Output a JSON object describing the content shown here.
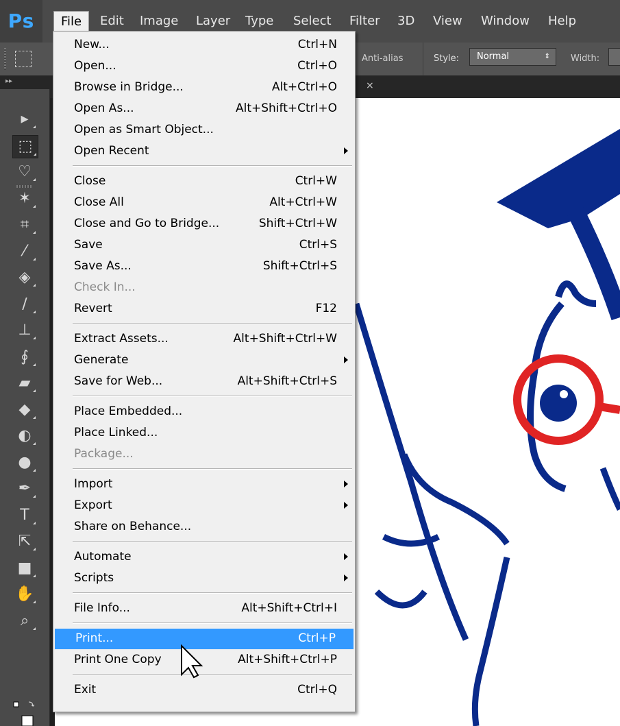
{
  "app": {
    "logo": "Ps"
  },
  "menubar": {
    "items": [
      "File",
      "Edit",
      "Image",
      "Layer",
      "Type",
      "Select",
      "Filter",
      "3D",
      "View",
      "Window",
      "Help"
    ],
    "active": "File"
  },
  "options_bar": {
    "anti_alias": "Anti-alias",
    "style_label": "Style:",
    "style_value": "Normal",
    "width_label": "Width:"
  },
  "tab_bar": {
    "close_glyph": "×"
  },
  "file_menu": {
    "groups": [
      [
        {
          "label": "New...",
          "shortcut": "Ctrl+N"
        },
        {
          "label": "Open...",
          "shortcut": "Ctrl+O"
        },
        {
          "label": "Browse in Bridge...",
          "shortcut": "Alt+Ctrl+O"
        },
        {
          "label": "Open As...",
          "shortcut": "Alt+Shift+Ctrl+O"
        },
        {
          "label": "Open as Smart Object...",
          "shortcut": ""
        },
        {
          "label": "Open Recent",
          "shortcut": "",
          "submenu": true
        }
      ],
      [
        {
          "label": "Close",
          "shortcut": "Ctrl+W"
        },
        {
          "label": "Close All",
          "shortcut": "Alt+Ctrl+W"
        },
        {
          "label": "Close and Go to Bridge...",
          "shortcut": "Shift+Ctrl+W"
        },
        {
          "label": "Save",
          "shortcut": "Ctrl+S"
        },
        {
          "label": "Save As...",
          "shortcut": "Shift+Ctrl+S"
        },
        {
          "label": "Check In...",
          "shortcut": "",
          "disabled": true
        },
        {
          "label": "Revert",
          "shortcut": "F12"
        }
      ],
      [
        {
          "label": "Extract Assets...",
          "shortcut": "Alt+Shift+Ctrl+W"
        },
        {
          "label": "Generate",
          "shortcut": "",
          "submenu": true
        },
        {
          "label": "Save for Web...",
          "shortcut": "Alt+Shift+Ctrl+S"
        }
      ],
      [
        {
          "label": "Place Embedded...",
          "shortcut": ""
        },
        {
          "label": "Place Linked...",
          "shortcut": ""
        },
        {
          "label": "Package...",
          "shortcut": "",
          "disabled": true
        }
      ],
      [
        {
          "label": "Import",
          "shortcut": "",
          "submenu": true
        },
        {
          "label": "Export",
          "shortcut": "",
          "submenu": true
        },
        {
          "label": "Share on Behance...",
          "shortcut": ""
        }
      ],
      [
        {
          "label": "Automate",
          "shortcut": "",
          "submenu": true
        },
        {
          "label": "Scripts",
          "shortcut": "",
          "submenu": true
        }
      ],
      [
        {
          "label": "File Info...",
          "shortcut": "Alt+Shift+Ctrl+I"
        }
      ],
      [
        {
          "label": "Print...",
          "shortcut": "Ctrl+P",
          "highlighted": true
        },
        {
          "label": "Print One Copy",
          "shortcut": "Alt+Shift+Ctrl+P"
        }
      ],
      [
        {
          "label": "Exit",
          "shortcut": "Ctrl+Q"
        }
      ]
    ]
  },
  "toolbar": {
    "tools": [
      {
        "name": "move-tool",
        "glyph": "▸"
      },
      {
        "name": "rectangular-marquee-tool",
        "glyph": "⬚",
        "selected": true
      },
      {
        "name": "lasso-tool",
        "glyph": "♡"
      },
      {
        "name": "magic-wand-tool",
        "glyph": "✶"
      },
      {
        "name": "crop-tool",
        "glyph": "⌗"
      },
      {
        "name": "eyedropper-tool",
        "glyph": "⁄"
      },
      {
        "name": "healing-brush-tool",
        "glyph": "◈"
      },
      {
        "name": "brush-tool",
        "glyph": "∕"
      },
      {
        "name": "clone-stamp-tool",
        "glyph": "⊥"
      },
      {
        "name": "history-brush-tool",
        "glyph": "∮"
      },
      {
        "name": "eraser-tool",
        "glyph": "▰"
      },
      {
        "name": "paint-bucket-tool",
        "glyph": "◆"
      },
      {
        "name": "blur-tool",
        "glyph": "◐"
      },
      {
        "name": "dodge-tool",
        "glyph": "●"
      },
      {
        "name": "pen-tool",
        "glyph": "✒"
      },
      {
        "name": "type-tool",
        "glyph": "T"
      },
      {
        "name": "path-selection-tool",
        "glyph": "⇱"
      },
      {
        "name": "rectangle-tool",
        "glyph": "■"
      },
      {
        "name": "hand-tool",
        "glyph": "✋"
      },
      {
        "name": "zoom-tool",
        "glyph": "⌕"
      }
    ]
  },
  "colors": {
    "accent_highlight": "#3399ff",
    "art_blue": "#0a2a8a",
    "art_red": "#e02424",
    "ps_blue": "#3ea8ff"
  }
}
